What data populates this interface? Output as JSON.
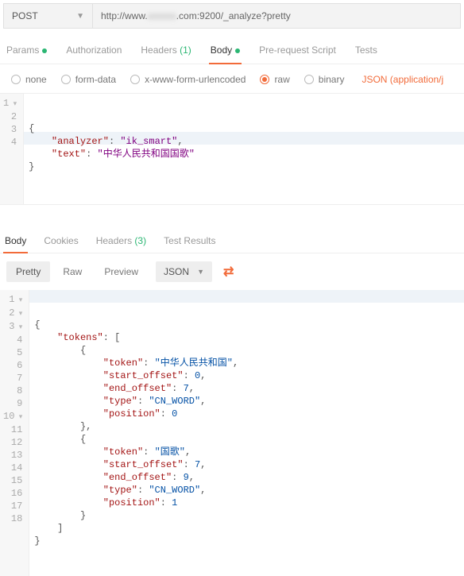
{
  "request": {
    "method": "POST",
    "url_prefix": "http://www.",
    "url_blur": "xxxxxx",
    "url_suffix": ".com:9200/_analyze?pretty",
    "tabs": {
      "params": "Params",
      "auth": "Authorization",
      "headers": "Headers",
      "headers_count": "(1)",
      "body": "Body",
      "prs": "Pre-request Script",
      "tests": "Tests"
    },
    "body_opts": {
      "none": "none",
      "form": "form-data",
      "xwww": "x-www-form-urlencoded",
      "raw": "raw",
      "binary": "binary",
      "json_type": "JSON (application/j"
    },
    "body_lines": {
      "l1": "{",
      "l2a": "    \"analyzer\"",
      "l2b": ": ",
      "l2c": "\"ik_smart\"",
      "l2d": ",",
      "l3a": "    \"text\"",
      "l3b": ": ",
      "l3c": "\"中华人民共和国国歌\"",
      "l4": "}"
    }
  },
  "response": {
    "tabs": {
      "body": "Body",
      "cookies": "Cookies",
      "headers": "Headers",
      "headers_count": "(3)",
      "tests": "Test Results"
    },
    "toolbar": {
      "pretty": "Pretty",
      "raw": "Raw",
      "preview": "Preview",
      "json": "JSON"
    },
    "body_lines": {
      "l1": "{",
      "l2a": "    \"tokens\"",
      "l2b": ": [",
      "l3": "        {",
      "l4a": "            \"token\"",
      "l4b": ": ",
      "l4c": "\"中华人民共和国\"",
      "l4d": ",",
      "l5a": "            \"start_offset\"",
      "l5b": ": ",
      "l5c": "0",
      "l5d": ",",
      "l6a": "            \"end_offset\"",
      "l6b": ": ",
      "l6c": "7",
      "l6d": ",",
      "l7a": "            \"type\"",
      "l7b": ": ",
      "l7c": "\"CN_WORD\"",
      "l7d": ",",
      "l8a": "            \"position\"",
      "l8b": ": ",
      "l8c": "0",
      "l9": "        },",
      "l10": "        {",
      "l11a": "            \"token\"",
      "l11b": ": ",
      "l11c": "\"国歌\"",
      "l11d": ",",
      "l12a": "            \"start_offset\"",
      "l12b": ": ",
      "l12c": "7",
      "l12d": ",",
      "l13a": "            \"end_offset\"",
      "l13b": ": ",
      "l13c": "9",
      "l13d": ",",
      "l14a": "            \"type\"",
      "l14b": ": ",
      "l14c": "\"CN_WORD\"",
      "l14d": ",",
      "l15a": "            \"position\"",
      "l15b": ": ",
      "l15c": "1",
      "l16": "        }",
      "l17": "    ]",
      "l18": "}"
    }
  }
}
